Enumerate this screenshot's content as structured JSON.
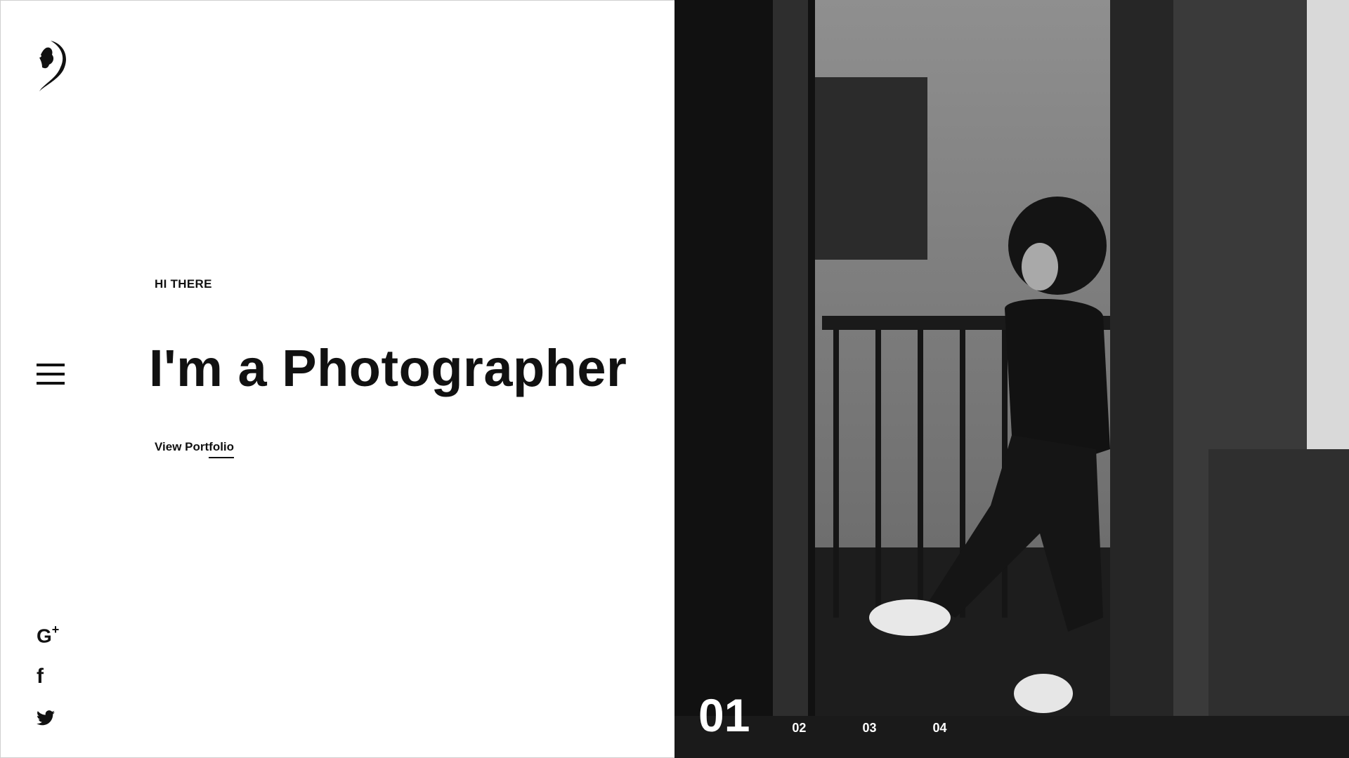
{
  "brand": {
    "logo_icon": "woman-profile-logo-icon"
  },
  "nav": {
    "menu_icon": "hamburger-menu-icon"
  },
  "social": [
    {
      "icon": "google-plus-icon",
      "label": "G",
      "suffix": "+"
    },
    {
      "icon": "facebook-icon",
      "label": "f"
    },
    {
      "icon": "twitter-icon"
    }
  ],
  "hero": {
    "eyebrow": "HI THERE",
    "headline": "I'm a Photographer",
    "cta_label": "View Portfolio"
  },
  "slider": {
    "current": "01",
    "pages": [
      "02",
      "03",
      "04"
    ]
  },
  "colors": {
    "text": "#111111",
    "background": "#ffffff",
    "pager_text": "#ffffff"
  }
}
